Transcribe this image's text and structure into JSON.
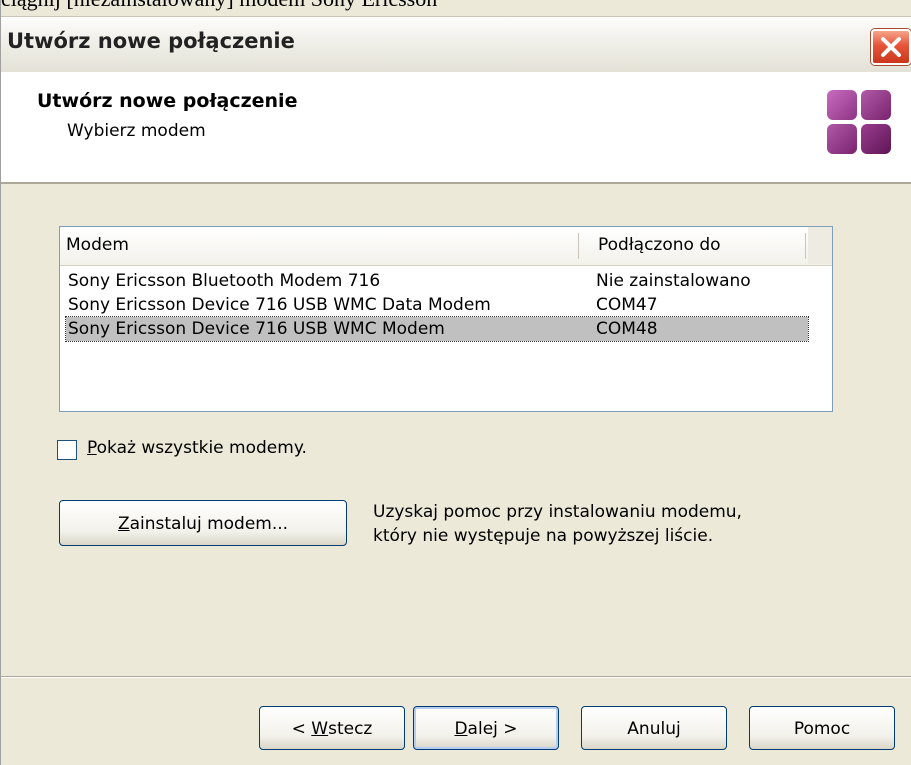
{
  "background_caption": "ciągnij [niezainstalowany] modem Sony Ericsson",
  "window": {
    "title": "Utwórz nowe połączenie"
  },
  "header": {
    "title": "Utwórz nowe połączenie",
    "subtitle": "Wybierz modem"
  },
  "modem_list": {
    "columns": [
      "Modem",
      "Podłączono do"
    ],
    "rows": [
      {
        "modem": "Sony Ericsson Bluetooth Modem 716",
        "port": "Nie zainstalowano",
        "selected": false
      },
      {
        "modem": "Sony Ericsson Device 716 USB WMC Data Modem",
        "port": "COM47",
        "selected": false
      },
      {
        "modem": "Sony Ericsson Device 716 USB WMC Modem",
        "port": "COM48",
        "selected": true
      }
    ]
  },
  "show_all": {
    "mnemonic": "P",
    "rest": "okaż wszystkie modemy.",
    "checked": false
  },
  "install": {
    "mnemonic": "Z",
    "rest": "ainstaluj modem...",
    "help_line1": "Uzyskaj pomoc przy instalowaniu modemu,",
    "help_line2": "który nie występuje na powyższej liście."
  },
  "buttons": {
    "back_prefix": "< ",
    "back_mnemonic": "W",
    "back_rest": "stecz",
    "next_mnemonic": "D",
    "next_rest": "alej >",
    "cancel": "Anuluj",
    "help": "Pomoc"
  },
  "colors": {
    "dialog_bg": "#ece9d8",
    "selection": "#c0c0c0",
    "close_button": "#e6553a",
    "logo": "#8e3483"
  }
}
